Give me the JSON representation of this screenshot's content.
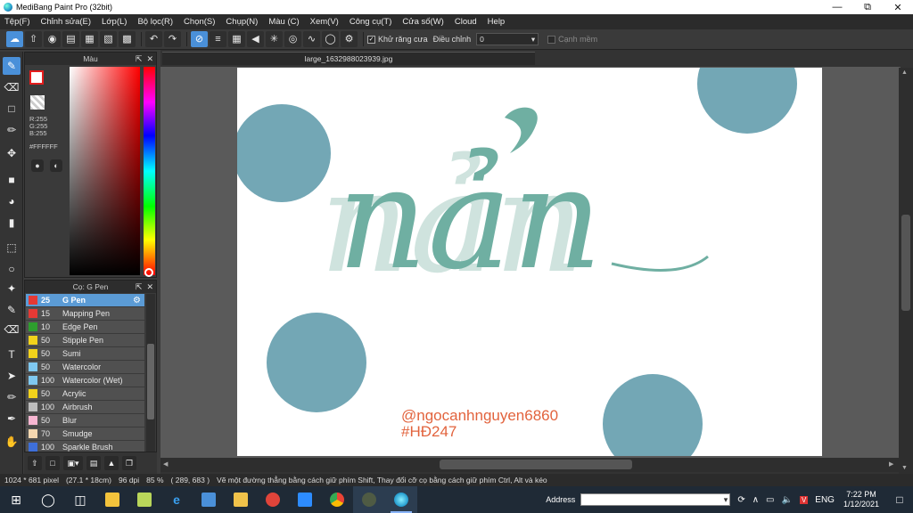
{
  "window": {
    "title": "MediBang Paint Pro (32bit)"
  },
  "menu": [
    "Tệp(F)",
    "Chỉnh sửa(E)",
    "Lớp(L)",
    "Bộ lọc(R)",
    "Chọn(S)",
    "Chụp(N)",
    "Màu (C)",
    "Xem(V)",
    "Công cụ(T)",
    "Cửa số(W)",
    "Cloud",
    "Help"
  ],
  "toolbar": {
    "antialias_label": "Khử răng cưa",
    "adjust_label": "Điều chỉnh",
    "adjust_value": "0",
    "smooth_label": "Cạnh mềm"
  },
  "color_panel": {
    "title": "Màu",
    "r": "R:255",
    "g": "G:255",
    "b": "B:255",
    "hex": "#FFFFFF",
    "foreground_color": "#FFFFFF",
    "accent_color": "#E51D1D"
  },
  "brush_panel": {
    "title": "Cọ: G Pen",
    "brushes": [
      {
        "size": "25",
        "name": "G Pen",
        "color": "#E53935",
        "selected": true
      },
      {
        "size": "15",
        "name": "Mapping Pen",
        "color": "#E53935"
      },
      {
        "size": "10",
        "name": "Edge Pen",
        "color": "#2E9E2E"
      },
      {
        "size": "50",
        "name": "Stipple Pen",
        "color": "#F2D21B"
      },
      {
        "size": "50",
        "name": "Sumi",
        "color": "#F2D21B"
      },
      {
        "size": "50",
        "name": "Watercolor",
        "color": "#7FC8F0"
      },
      {
        "size": "100",
        "name": "Watercolor (Wet)",
        "color": "#7FC8F0"
      },
      {
        "size": "50",
        "name": "Acrylic",
        "color": "#F2D21B"
      },
      {
        "size": "100",
        "name": "Airbrush",
        "color": "#BDBDBD"
      },
      {
        "size": "50",
        "name": "Blur",
        "color": "#F7B6D2"
      },
      {
        "size": "70",
        "name": "Smudge",
        "color": "#F5D7B0"
      },
      {
        "size": "100",
        "name": "Sparkle Brush",
        "color": "#3E6FD8"
      }
    ]
  },
  "document": {
    "tab_name": "large_1632988023939.jpg"
  },
  "canvas": {
    "title_text": "nản",
    "watermark_handle": "@ngocanhnguyen6860",
    "watermark_tag": "#HĐ247",
    "teal_color": "#6FAFA2",
    "shadow_color": "#CFE3DE",
    "circle_color": "#73A7B5",
    "watermark_color": "#E2633D"
  },
  "status": {
    "size": "1024 * 681 pixel",
    "cm": "(27.1 * 18cm)",
    "dpi": "96 dpi",
    "zoom": "85 %",
    "coords": "( 289, 683 )",
    "hint": "Vẽ một đường thẳng bằng cách giữ phím Shift, Thay đổi cỡ cọ bằng cách giữ phím Ctrl, Alt và kéo"
  },
  "taskbar": {
    "address_label": "Address",
    "lang": "ENG",
    "time": "7:22 PM",
    "date": "1/12/2021"
  }
}
